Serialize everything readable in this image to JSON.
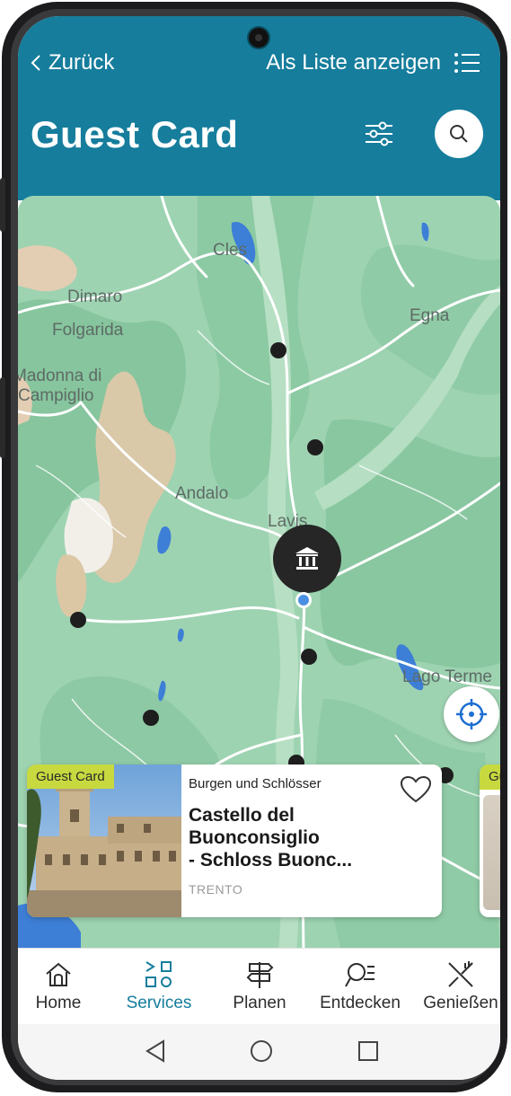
{
  "header": {
    "back_label": "Zurück",
    "list_view_label": "Als Liste anzeigen",
    "title": "Guest Card"
  },
  "map": {
    "places": [
      "Cles",
      "Dimaro",
      "Folgarida",
      "Madonna di",
      "Campiglio",
      "Egna",
      "Andalo",
      "Lavis",
      "Lago Terme"
    ]
  },
  "card": {
    "badge": "Guest Card",
    "category": "Burgen und Schlösser",
    "title_lines": [
      "Castello del",
      "Buonconsiglio",
      "- Schloss Buonc..."
    ],
    "location": "TRENTO"
  },
  "card_next": {
    "badge": "Guest Card"
  },
  "nav": {
    "items": [
      {
        "label": "Home",
        "icon": "home-icon"
      },
      {
        "label": "Services",
        "icon": "services-icon"
      },
      {
        "label": "Planen",
        "icon": "signpost-icon"
      },
      {
        "label": "Entdecken",
        "icon": "discover-icon"
      },
      {
        "label": "Genießen",
        "icon": "cutlery-icon"
      }
    ],
    "active": "Services"
  },
  "colors": {
    "brand": "#167d9c",
    "badge": "#c7d93f",
    "map_green": "#9cd3b0"
  }
}
